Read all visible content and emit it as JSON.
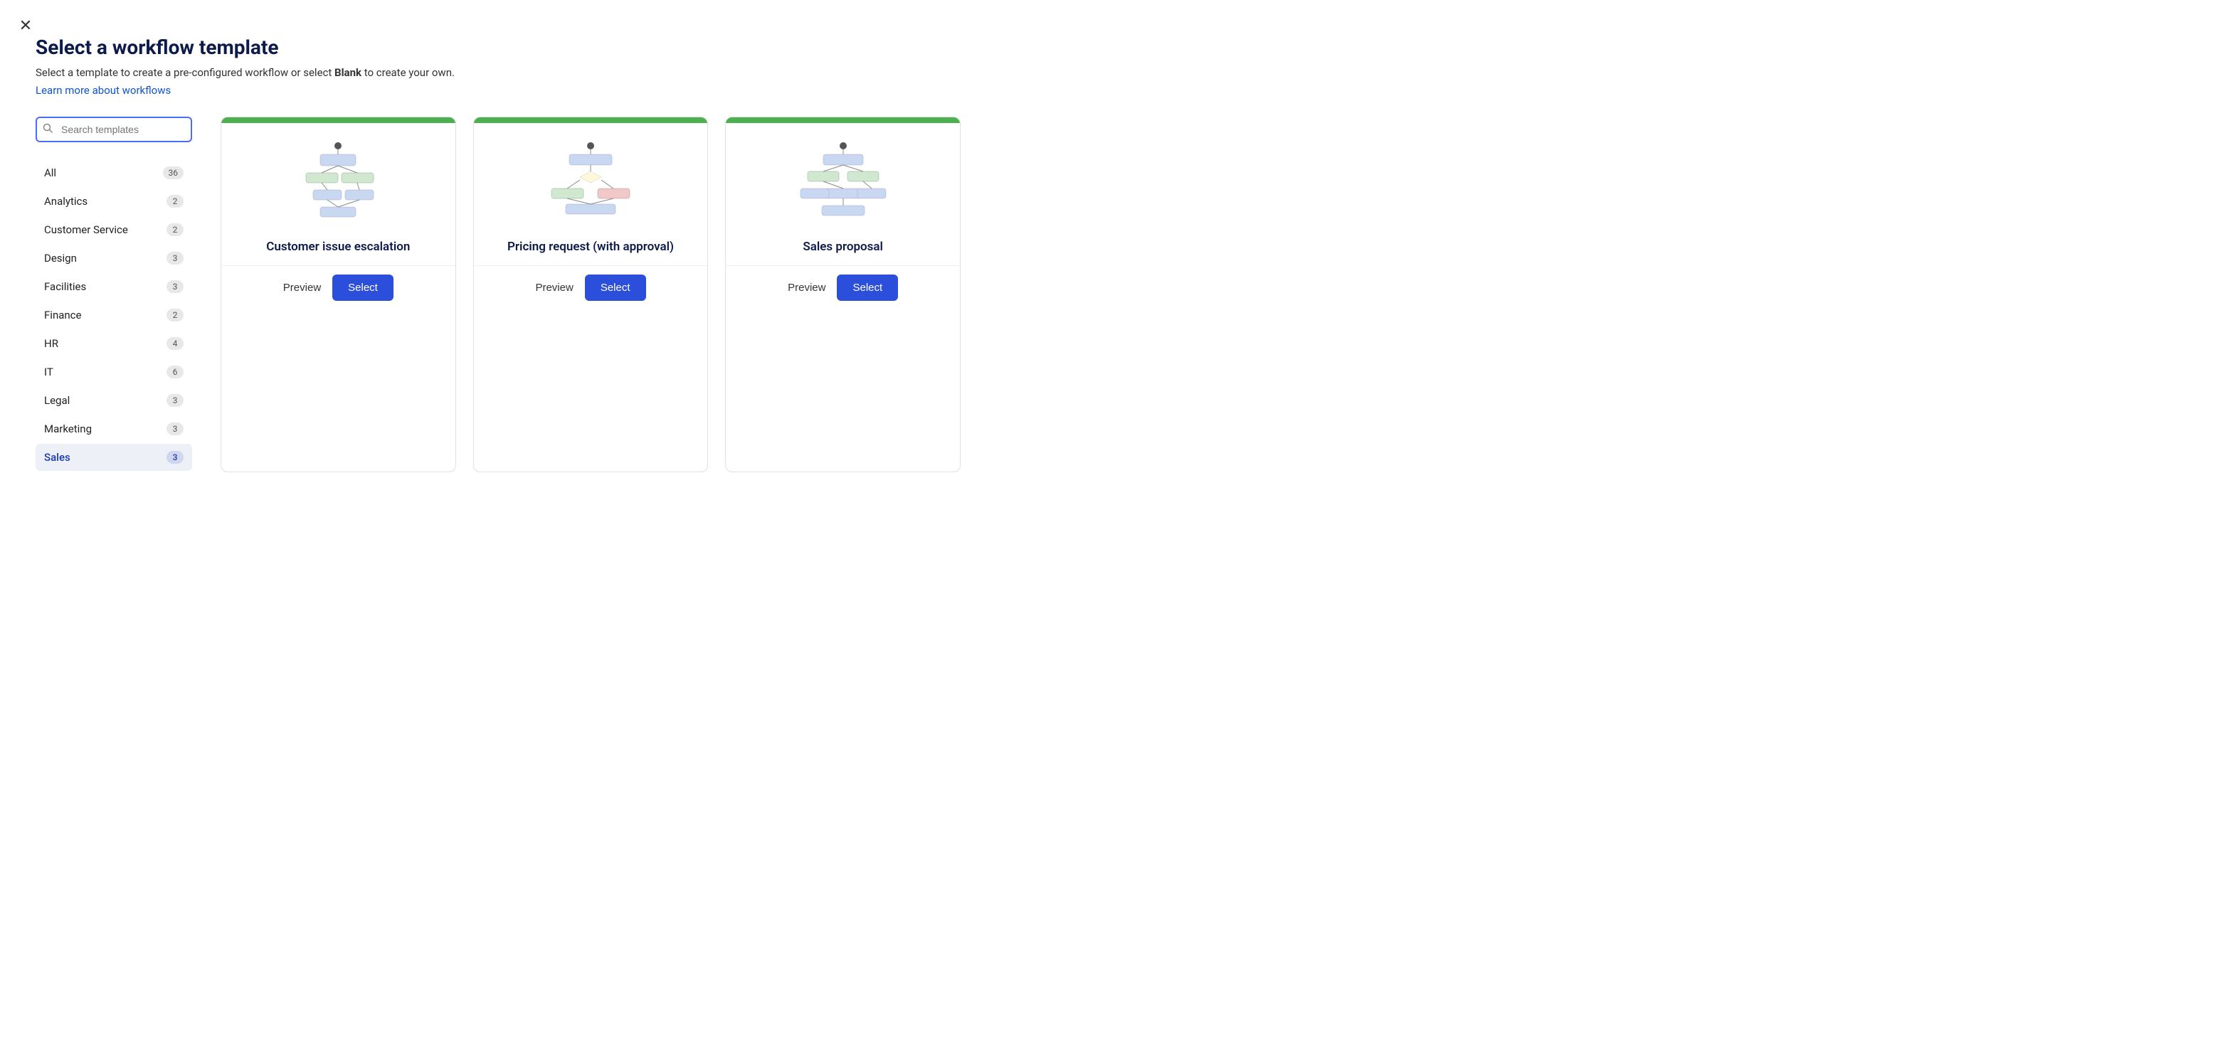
{
  "close_label": "✕",
  "page": {
    "title": "Select a workflow template",
    "subtitle": "Select a template to create a pre-configured workflow or select ",
    "subtitle_bold": "Blank",
    "subtitle_end": " to create your own.",
    "learn_link": "Learn more about workflows"
  },
  "search": {
    "placeholder": "Search templates"
  },
  "categories": [
    {
      "id": "all",
      "label": "All",
      "count": "36",
      "active": false
    },
    {
      "id": "analytics",
      "label": "Analytics",
      "count": "2",
      "active": false
    },
    {
      "id": "customer-service",
      "label": "Customer Service",
      "count": "2",
      "active": false
    },
    {
      "id": "design",
      "label": "Design",
      "count": "3",
      "active": false
    },
    {
      "id": "facilities",
      "label": "Facilities",
      "count": "3",
      "active": false
    },
    {
      "id": "finance",
      "label": "Finance",
      "count": "2",
      "active": false
    },
    {
      "id": "hr",
      "label": "HR",
      "count": "4",
      "active": false
    },
    {
      "id": "it",
      "label": "IT",
      "count": "6",
      "active": false
    },
    {
      "id": "legal",
      "label": "Legal",
      "count": "3",
      "active": false
    },
    {
      "id": "marketing",
      "label": "Marketing",
      "count": "3",
      "active": false
    },
    {
      "id": "sales",
      "label": "Sales",
      "count": "3",
      "active": true
    }
  ],
  "templates": [
    {
      "id": "customer-issue-escalation",
      "title": "Customer issue escalation",
      "preview_label": "Preview",
      "select_label": "Select"
    },
    {
      "id": "pricing-request-approval",
      "title": "Pricing request (with approval)",
      "preview_label": "Preview",
      "select_label": "Select"
    },
    {
      "id": "sales-proposal",
      "title": "Sales proposal",
      "preview_label": "Preview",
      "select_label": "Select"
    }
  ]
}
